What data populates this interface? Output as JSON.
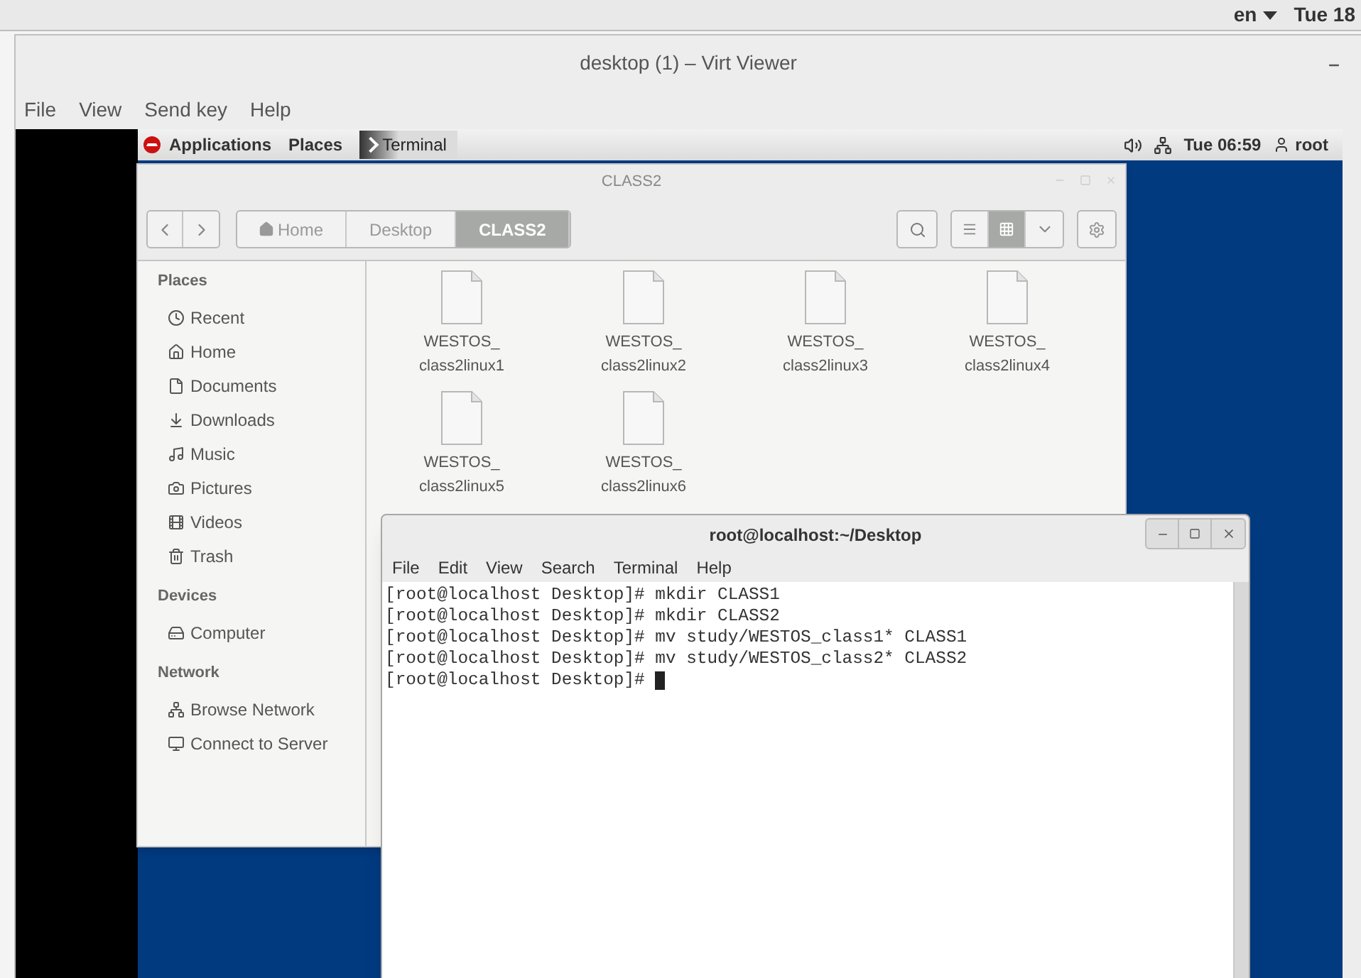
{
  "host_bar": {
    "language": "en",
    "clock": "Tue 18"
  },
  "viewer": {
    "title": "desktop (1) – Virt Viewer",
    "menu": [
      "File",
      "View",
      "Send key",
      "Help"
    ]
  },
  "guest_panel": {
    "items": [
      "Applications",
      "Places"
    ],
    "task": "Terminal",
    "clock": "Tue 06:59",
    "user": "root"
  },
  "file_manager": {
    "title": "CLASS2",
    "path": [
      {
        "label": "Home",
        "kind": "home",
        "selected": false
      },
      {
        "label": "Desktop",
        "kind": "plain",
        "selected": false
      },
      {
        "label": "CLASS2",
        "kind": "plain",
        "selected": true
      }
    ],
    "view_modes": [
      {
        "kind": "list",
        "selected": false
      },
      {
        "kind": "grid",
        "selected": true
      }
    ],
    "sidebar": [
      {
        "heading": "Places",
        "items": [
          {
            "label": "Recent",
            "kind": "recent"
          },
          {
            "label": "Home",
            "kind": "home"
          },
          {
            "label": "Documents",
            "kind": "documents"
          },
          {
            "label": "Downloads",
            "kind": "downloads"
          },
          {
            "label": "Music",
            "kind": "music"
          },
          {
            "label": "Pictures",
            "kind": "pictures"
          },
          {
            "label": "Videos",
            "kind": "videos"
          },
          {
            "label": "Trash",
            "kind": "trash"
          }
        ]
      },
      {
        "heading": "Devices",
        "items": [
          {
            "label": "Computer",
            "kind": "computer"
          }
        ]
      },
      {
        "heading": "Network",
        "items": [
          {
            "label": "Browse Network",
            "kind": "network"
          },
          {
            "label": "Connect to Server",
            "kind": "server"
          }
        ]
      }
    ],
    "files": [
      "WESTOS_class2linux1",
      "WESTOS_class2linux2",
      "WESTOS_class2linux3",
      "WESTOS_class2linux4",
      "WESTOS_class2linux5",
      "WESTOS_class2linux6"
    ]
  },
  "terminal": {
    "title": "root@localhost:~/Desktop",
    "menu": [
      "File",
      "Edit",
      "View",
      "Search",
      "Terminal",
      "Help"
    ],
    "lines": [
      "[root@localhost Desktop]# mkdir CLASS1",
      "[root@localhost Desktop]# mkdir CLASS2",
      "[root@localhost Desktop]# mv study/WESTOS_class1* CLASS1",
      "[root@localhost Desktop]# mv study/WESTOS_class2* CLASS2",
      "[root@localhost Desktop]# "
    ]
  }
}
